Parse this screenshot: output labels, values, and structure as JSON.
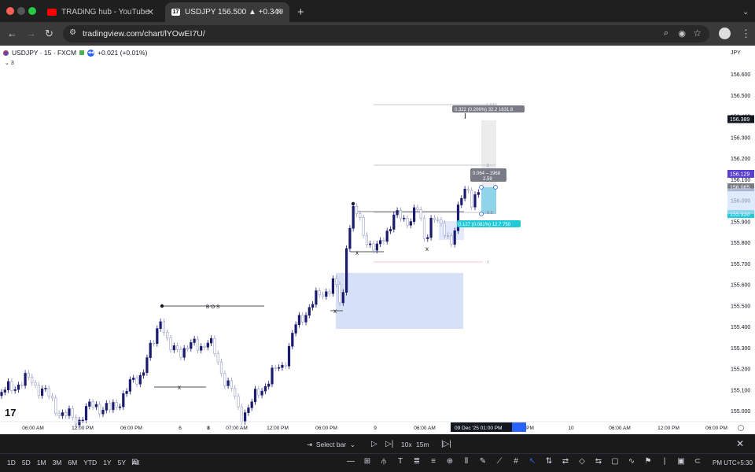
{
  "browser": {
    "tabs": [
      {
        "title": "TRADiNG hub - YouTube"
      },
      {
        "title": "USDJPY 156.500 ▲ +0.34% ..."
      }
    ],
    "url": "tradingview.com/chart/lYOwEI7U/"
  },
  "symbol": {
    "name": "USDJPY · 15 · FXCM",
    "change": "+0.021 (+0.01%)",
    "collapse": "3",
    "currency": "JPY"
  },
  "price_axis": {
    "ticks": [
      "156.600",
      "156.500",
      "156.400",
      "156.300",
      "156.200",
      "156.100",
      "156.000",
      "155.900",
      "155.800",
      "155.700",
      "155.600",
      "155.500",
      "155.400",
      "155.300",
      "155.200",
      "155.100",
      "155.000"
    ],
    "labels": [
      {
        "text": "156.389",
        "bg": "#131722"
      },
      {
        "text": "156.129",
        "bg": "#5b3fd0"
      },
      {
        "text": "156.065",
        "bg": "#787b86"
      },
      {
        "text": "155.938",
        "bg": "#22c9d6"
      }
    ]
  },
  "time_axis": {
    "ticks": [
      "06:00 AM",
      "12:00 PM",
      "06:00 PM",
      "6",
      "8",
      "07:00 AM",
      "12:00 PM",
      "06:00 PM",
      "9",
      "06:00 AM",
      "PM",
      "10",
      "06:00 AM",
      "12:00 PM",
      "06:00 PM"
    ],
    "cursor_label": "09 Dec '25   01:00 PM"
  },
  "annotations": {
    "bos": "B O S",
    "x_marks": [
      "x",
      "x",
      "x",
      "x"
    ],
    "measure_top": "0.322 (0.206%) 32.2 1631.8",
    "measure_mid_1": "0.064 – 1968",
    "measure_mid_2": "2.59",
    "measure_bottom": "0.127 (0.081%) 12.7 750",
    "fib_top": "1.618",
    "fib_one": "1",
    "fib_half": "0.5",
    "fib_zero": "0"
  },
  "bottom_bar": {
    "select_bar": "Select bar",
    "speed": "10x",
    "interval": "15m",
    "ranges": [
      "1D",
      "5D",
      "1M",
      "3M",
      "6M",
      "YTD",
      "1Y",
      "5Y",
      "All"
    ],
    "timezone": "PM UTC+5:30"
  },
  "colors": {
    "bull": "#1a1a6e",
    "bear": "#9aa0c8",
    "zone": "#d6e0f7",
    "accent": "#2962ff"
  }
}
